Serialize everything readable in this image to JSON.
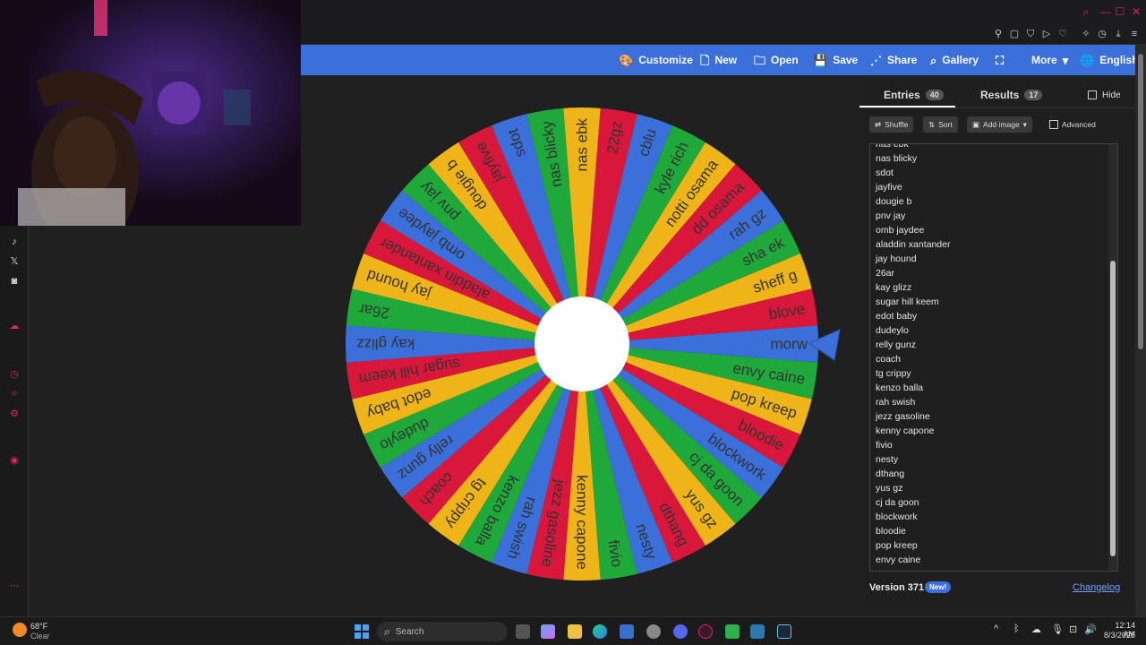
{
  "toolbar": {
    "customize": "Customize",
    "new": "New",
    "open": "Open",
    "save": "Save",
    "share": "Share",
    "gallery": "Gallery",
    "more": "More",
    "language": "English"
  },
  "tabs": {
    "entries_label": "Entries",
    "entries_count": "40",
    "results_label": "Results",
    "results_count": "17",
    "hide_label": "Hide"
  },
  "controls": {
    "shuffle": "Shuffle",
    "sort": "Sort",
    "add_image": "Add image",
    "advanced": "Advanced"
  },
  "entries_partial_top": "nas ebk",
  "entries": [
    "nas blicky",
    "sdot",
    "jayfive",
    "dougie b",
    "pnv jay",
    "omb jaydee",
    "aladdin xantander",
    "jay hound",
    "26ar",
    "kay glizz",
    "sugar hill keem",
    "edot baby",
    "dudeylo",
    "relly gunz",
    "coach",
    "tg crippy",
    "kenzo balla",
    "rah swish",
    "jezz gasoline",
    "kenny capone",
    "fivio",
    "nesty",
    "dthang",
    "yus gz",
    "cj da goon",
    "blockwork",
    "bloodie",
    "pop kreep",
    "envy caine"
  ],
  "footer": {
    "version": "Version 371",
    "new_badge": "New!",
    "changelog": "Changelog"
  },
  "wheel": {
    "labels": [
      "morw",
      "envy caine",
      "pop kreep",
      "bloodie",
      "blockwork",
      "cj da goon",
      "yus gz",
      "dthang",
      "nesty",
      "fivio",
      "kenny capone",
      "jezz gasoline",
      "rah swish",
      "kenzo balla",
      "tg crippy",
      "coach",
      "relly gunz",
      "dudeylo",
      "edot baby",
      "sugar hill keem",
      "kay glizz",
      "26ar",
      "jay hound",
      "aladdin xantander",
      "omb jaydee",
      "pnv jay",
      "dougie b",
      "jayfive",
      "sdot",
      "nas blicky",
      "nas ebk",
      "22gz",
      "cblu",
      "kyle rich",
      "notti osama",
      "dd osama",
      "rah gz",
      "sha ek",
      "sheff g",
      "blove"
    ],
    "colors": [
      "#3b6fd9",
      "#1fa93a",
      "#efb418",
      "#d9173a"
    ],
    "text_color": "#333333"
  },
  "taskbar": {
    "weather_temp": "68°F",
    "weather_desc": "Clear",
    "search": "Search",
    "time": "12:14 AM",
    "date": "8/3/2025"
  }
}
